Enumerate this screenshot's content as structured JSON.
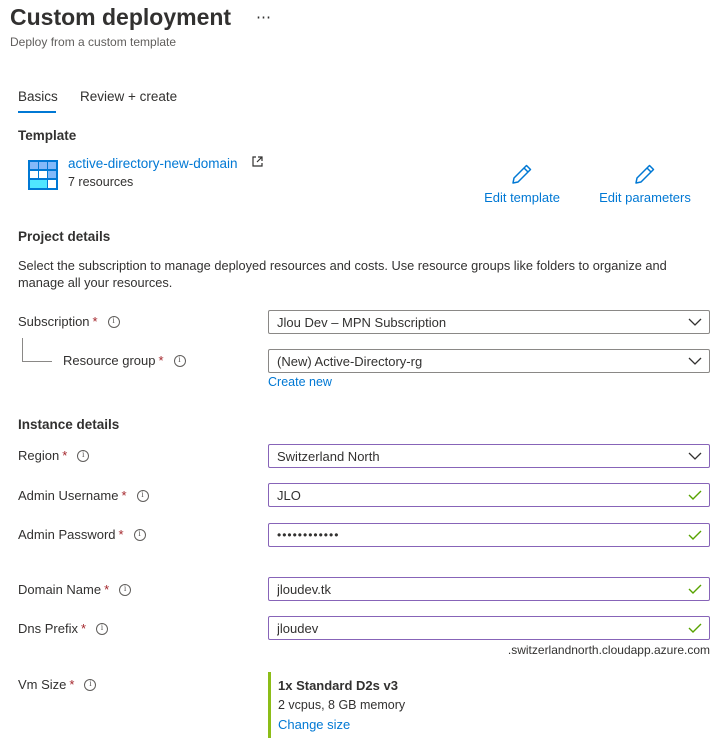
{
  "header": {
    "title": "Custom deployment",
    "subtitle": "Deploy from a custom template",
    "more_label": "⋯"
  },
  "tabs": [
    {
      "label": "Basics",
      "selected": true
    },
    {
      "label": "Review + create",
      "selected": false
    }
  ],
  "template": {
    "heading": "Template",
    "name": "active-directory-new-domain",
    "resources": "7 resources",
    "edit_template": "Edit template",
    "edit_parameters": "Edit parameters"
  },
  "project": {
    "heading": "Project details",
    "description": "Select the subscription to manage deployed resources and costs. Use resource groups like folders to organize and manage all your resources.",
    "subscription_label": "Subscription",
    "subscription_value": "Jlou Dev – MPN Subscription",
    "resource_group_label": "Resource group",
    "resource_group_value": "(New) Active-Directory-rg",
    "create_new": "Create new"
  },
  "instance": {
    "heading": "Instance details",
    "region_label": "Region",
    "region_value": "Switzerland North",
    "admin_username_label": "Admin Username",
    "admin_username_value": "JLO",
    "admin_password_label": "Admin Password",
    "admin_password_value": "••••••••••••",
    "domain_name_label": "Domain Name",
    "domain_name_value": "jloudev.tk",
    "dns_prefix_label": "Dns Prefix",
    "dns_prefix_value": "jloudev",
    "dns_suffix": ".switzerlandnorth.cloudapp.azure.com",
    "vm_size_label": "Vm Size",
    "vm_size_name": "1x Standard D2s v3",
    "vm_size_spec": "2 vcpus, 8 GB memory",
    "change_size": "Change size"
  },
  "required_marker": "*",
  "colors": {
    "accent": "#0078d4",
    "focus_border": "#8764b8",
    "valid_check": "#57a300",
    "required": "#a4262c",
    "vm_bar": "#8cbd18"
  }
}
